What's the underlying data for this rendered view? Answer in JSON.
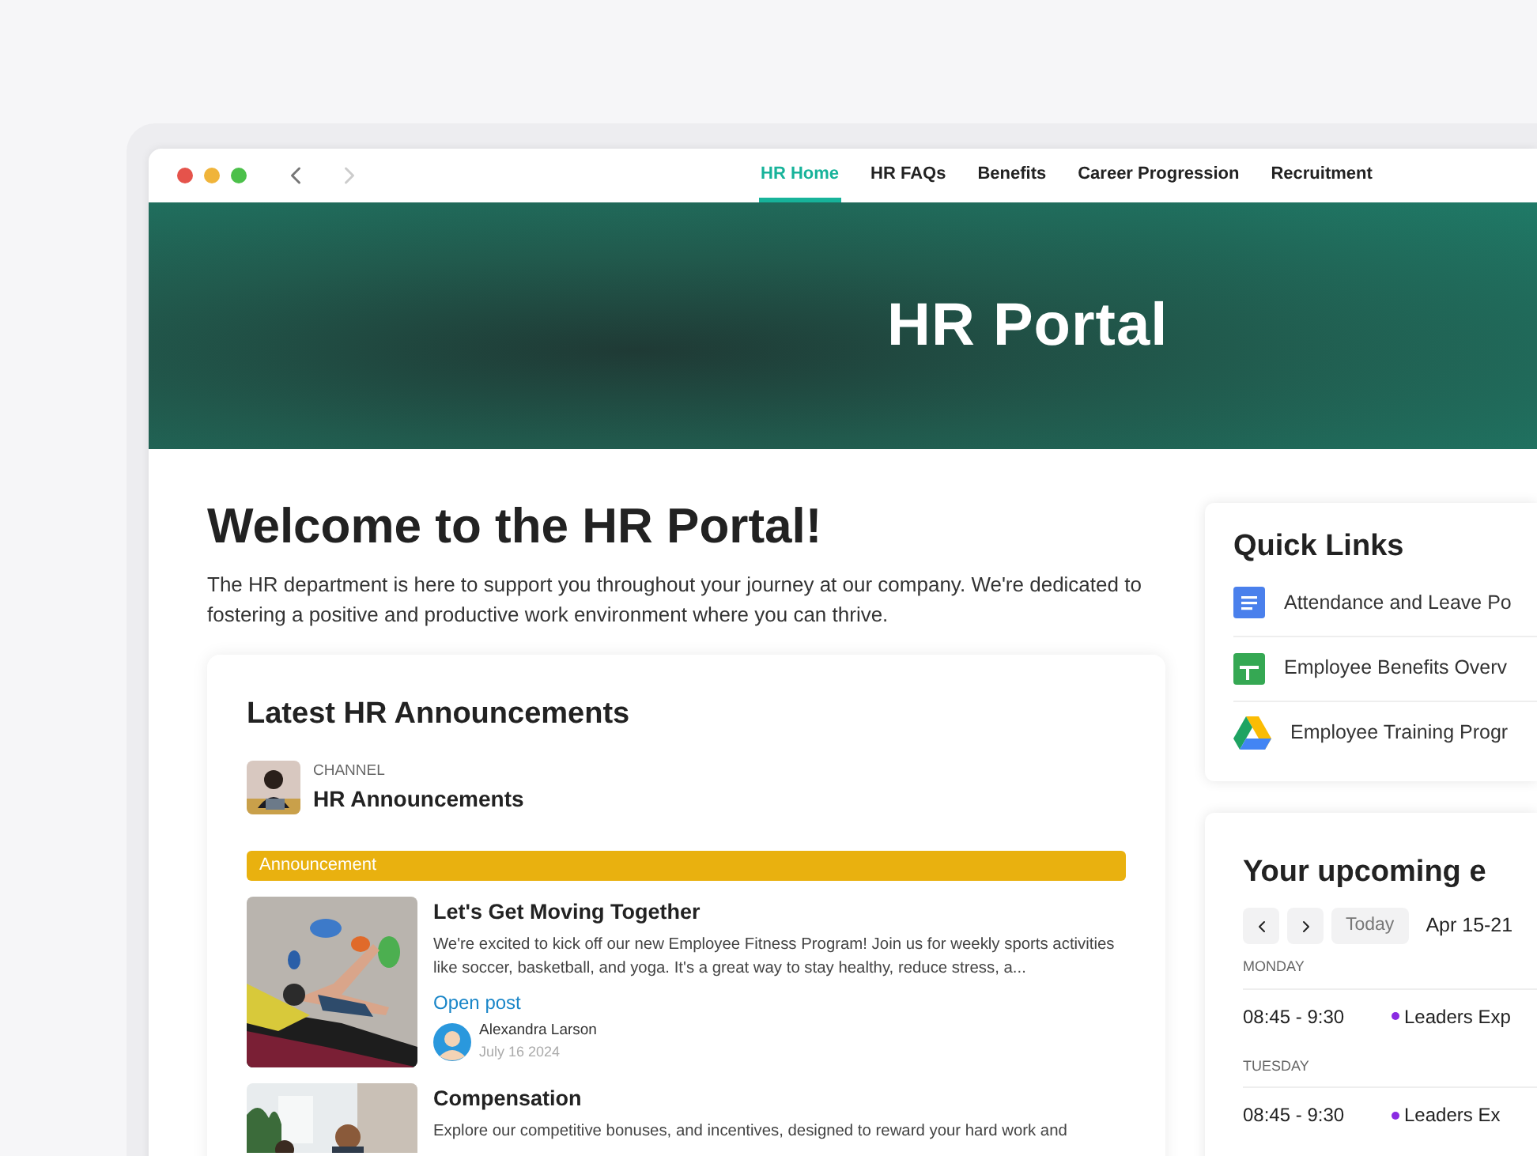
{
  "browser": {
    "tabs": [
      {
        "label": "HR Home",
        "selected": true
      },
      {
        "label": "HR FAQs",
        "selected": false
      },
      {
        "label": "Benefits",
        "selected": false
      },
      {
        "label": "Career Progression",
        "selected": false
      },
      {
        "label": "Recruitment",
        "selected": false
      }
    ]
  },
  "banner": {
    "title": "HR Portal"
  },
  "welcome": {
    "title": "Welcome to the HR Portal!",
    "text": "The HR department is here to support you throughout your journey at our company. We're dedicated to fostering a positive and productive work environment where you can thrive."
  },
  "announcements": {
    "title": "Latest HR Announcements",
    "channel_label": "CHANNEL",
    "channel_name": "HR Announcements",
    "tag": "Announcement",
    "posts": [
      {
        "title": "Let's Get Moving Together",
        "text": "We're excited to kick off our new Employee Fitness Program! Join us for weekly sports activities like soccer, basketball, and yoga. It's a great way to stay healthy, reduce stress, a...",
        "link": "Open post",
        "author": "Alexandra Larson",
        "date": "July 16 2024"
      },
      {
        "title": "Compensation",
        "text": "Explore our competitive bonuses, and incentives, designed to reward your hard work and"
      }
    ]
  },
  "quick_links": {
    "title": "Quick Links",
    "items": [
      {
        "kind": "doc",
        "label": "Attendance and Leave Po"
      },
      {
        "kind": "sheet",
        "label": "Employee Benefits Overv"
      },
      {
        "kind": "drive",
        "label": "Employee Training Progr"
      }
    ]
  },
  "events": {
    "title": "Your upcoming e",
    "today": "Today",
    "range": "Apr 15-21",
    "days": [
      {
        "day": "MONDAY",
        "events": [
          {
            "time": "08:45 - 9:30",
            "title": "Leaders Exp",
            "color": "#8a2be2"
          }
        ]
      },
      {
        "day": "TUESDAY",
        "events": [
          {
            "time": "08:45 - 9:30",
            "title": "Leaders Ex",
            "color": "#8a2be2"
          }
        ]
      }
    ]
  }
}
